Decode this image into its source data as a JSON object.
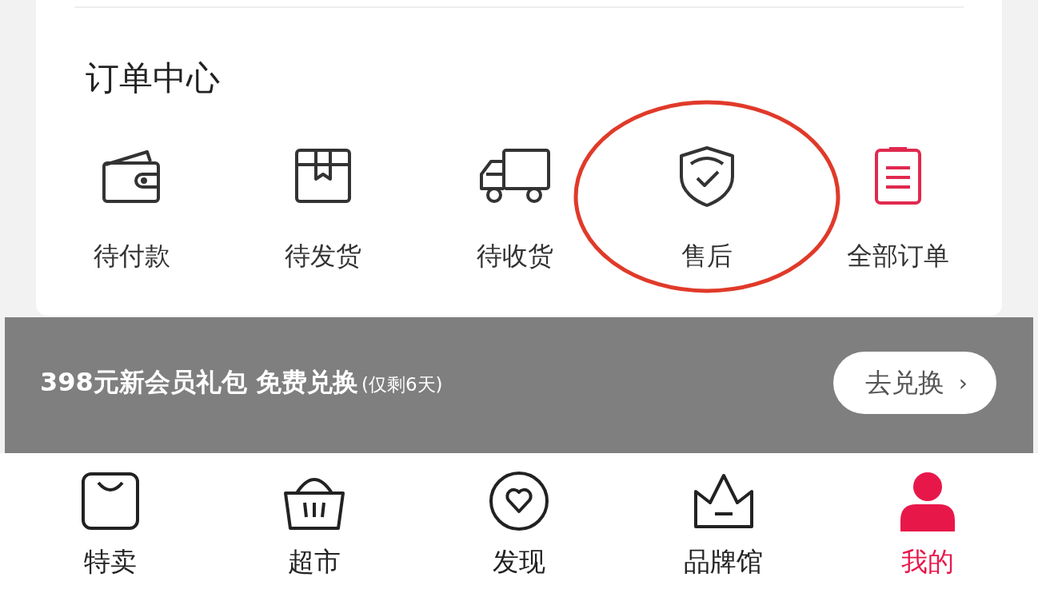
{
  "order_center": {
    "title": "订单中心",
    "items": [
      {
        "label": "待付款",
        "kind": "wallet",
        "color": "#333333",
        "circled": false
      },
      {
        "label": "待发货",
        "kind": "box",
        "color": "#333333",
        "circled": false
      },
      {
        "label": "待收货",
        "kind": "truck",
        "color": "#333333",
        "circled": false
      },
      {
        "label": "售后",
        "kind": "shield",
        "color": "#333333",
        "circled": true
      },
      {
        "label": "全部订单",
        "kind": "clipboard",
        "color": "#e0294f",
        "circled": false
      }
    ]
  },
  "promo_banner": {
    "text": "398元新会员礼包 免费兑换",
    "note": "(仅剩6天)",
    "button": "去兑换",
    "button_arrow": "›"
  },
  "tab_bar": [
    {
      "label": "特卖",
      "kind": "bag",
      "selected": false
    },
    {
      "label": "超市",
      "kind": "basket",
      "selected": false
    },
    {
      "label": "发现",
      "kind": "heart",
      "selected": false
    },
    {
      "label": "品牌馆",
      "kind": "crown",
      "selected": false
    },
    {
      "label": "我的",
      "kind": "person",
      "selected": true
    }
  ]
}
